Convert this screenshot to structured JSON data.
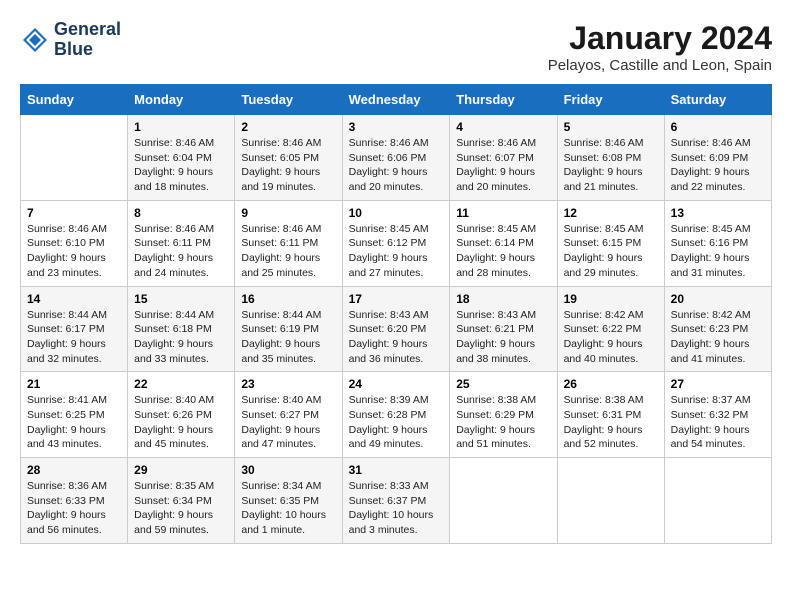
{
  "header": {
    "logo_line1": "General",
    "logo_line2": "Blue",
    "title": "January 2024",
    "subtitle": "Pelayos, Castille and Leon, Spain"
  },
  "calendar": {
    "columns": [
      "Sunday",
      "Monday",
      "Tuesday",
      "Wednesday",
      "Thursday",
      "Friday",
      "Saturday"
    ],
    "weeks": [
      [
        {
          "day": "",
          "info": ""
        },
        {
          "day": "1",
          "info": "Sunrise: 8:46 AM\nSunset: 6:04 PM\nDaylight: 9 hours\nand 18 minutes."
        },
        {
          "day": "2",
          "info": "Sunrise: 8:46 AM\nSunset: 6:05 PM\nDaylight: 9 hours\nand 19 minutes."
        },
        {
          "day": "3",
          "info": "Sunrise: 8:46 AM\nSunset: 6:06 PM\nDaylight: 9 hours\nand 20 minutes."
        },
        {
          "day": "4",
          "info": "Sunrise: 8:46 AM\nSunset: 6:07 PM\nDaylight: 9 hours\nand 20 minutes."
        },
        {
          "day": "5",
          "info": "Sunrise: 8:46 AM\nSunset: 6:08 PM\nDaylight: 9 hours\nand 21 minutes."
        },
        {
          "day": "6",
          "info": "Sunrise: 8:46 AM\nSunset: 6:09 PM\nDaylight: 9 hours\nand 22 minutes."
        }
      ],
      [
        {
          "day": "7",
          "info": "Sunrise: 8:46 AM\nSunset: 6:10 PM\nDaylight: 9 hours\nand 23 minutes."
        },
        {
          "day": "8",
          "info": "Sunrise: 8:46 AM\nSunset: 6:11 PM\nDaylight: 9 hours\nand 24 minutes."
        },
        {
          "day": "9",
          "info": "Sunrise: 8:46 AM\nSunset: 6:11 PM\nDaylight: 9 hours\nand 25 minutes."
        },
        {
          "day": "10",
          "info": "Sunrise: 8:45 AM\nSunset: 6:12 PM\nDaylight: 9 hours\nand 27 minutes."
        },
        {
          "day": "11",
          "info": "Sunrise: 8:45 AM\nSunset: 6:14 PM\nDaylight: 9 hours\nand 28 minutes."
        },
        {
          "day": "12",
          "info": "Sunrise: 8:45 AM\nSunset: 6:15 PM\nDaylight: 9 hours\nand 29 minutes."
        },
        {
          "day": "13",
          "info": "Sunrise: 8:45 AM\nSunset: 6:16 PM\nDaylight: 9 hours\nand 31 minutes."
        }
      ],
      [
        {
          "day": "14",
          "info": "Sunrise: 8:44 AM\nSunset: 6:17 PM\nDaylight: 9 hours\nand 32 minutes."
        },
        {
          "day": "15",
          "info": "Sunrise: 8:44 AM\nSunset: 6:18 PM\nDaylight: 9 hours\nand 33 minutes."
        },
        {
          "day": "16",
          "info": "Sunrise: 8:44 AM\nSunset: 6:19 PM\nDaylight: 9 hours\nand 35 minutes."
        },
        {
          "day": "17",
          "info": "Sunrise: 8:43 AM\nSunset: 6:20 PM\nDaylight: 9 hours\nand 36 minutes."
        },
        {
          "day": "18",
          "info": "Sunrise: 8:43 AM\nSunset: 6:21 PM\nDaylight: 9 hours\nand 38 minutes."
        },
        {
          "day": "19",
          "info": "Sunrise: 8:42 AM\nSunset: 6:22 PM\nDaylight: 9 hours\nand 40 minutes."
        },
        {
          "day": "20",
          "info": "Sunrise: 8:42 AM\nSunset: 6:23 PM\nDaylight: 9 hours\nand 41 minutes."
        }
      ],
      [
        {
          "day": "21",
          "info": "Sunrise: 8:41 AM\nSunset: 6:25 PM\nDaylight: 9 hours\nand 43 minutes."
        },
        {
          "day": "22",
          "info": "Sunrise: 8:40 AM\nSunset: 6:26 PM\nDaylight: 9 hours\nand 45 minutes."
        },
        {
          "day": "23",
          "info": "Sunrise: 8:40 AM\nSunset: 6:27 PM\nDaylight: 9 hours\nand 47 minutes."
        },
        {
          "day": "24",
          "info": "Sunrise: 8:39 AM\nSunset: 6:28 PM\nDaylight: 9 hours\nand 49 minutes."
        },
        {
          "day": "25",
          "info": "Sunrise: 8:38 AM\nSunset: 6:29 PM\nDaylight: 9 hours\nand 51 minutes."
        },
        {
          "day": "26",
          "info": "Sunrise: 8:38 AM\nSunset: 6:31 PM\nDaylight: 9 hours\nand 52 minutes."
        },
        {
          "day": "27",
          "info": "Sunrise: 8:37 AM\nSunset: 6:32 PM\nDaylight: 9 hours\nand 54 minutes."
        }
      ],
      [
        {
          "day": "28",
          "info": "Sunrise: 8:36 AM\nSunset: 6:33 PM\nDaylight: 9 hours\nand 56 minutes."
        },
        {
          "day": "29",
          "info": "Sunrise: 8:35 AM\nSunset: 6:34 PM\nDaylight: 9 hours\nand 59 minutes."
        },
        {
          "day": "30",
          "info": "Sunrise: 8:34 AM\nSunset: 6:35 PM\nDaylight: 10 hours\nand 1 minute."
        },
        {
          "day": "31",
          "info": "Sunrise: 8:33 AM\nSunset: 6:37 PM\nDaylight: 10 hours\nand 3 minutes."
        },
        {
          "day": "",
          "info": ""
        },
        {
          "day": "",
          "info": ""
        },
        {
          "day": "",
          "info": ""
        }
      ]
    ]
  }
}
